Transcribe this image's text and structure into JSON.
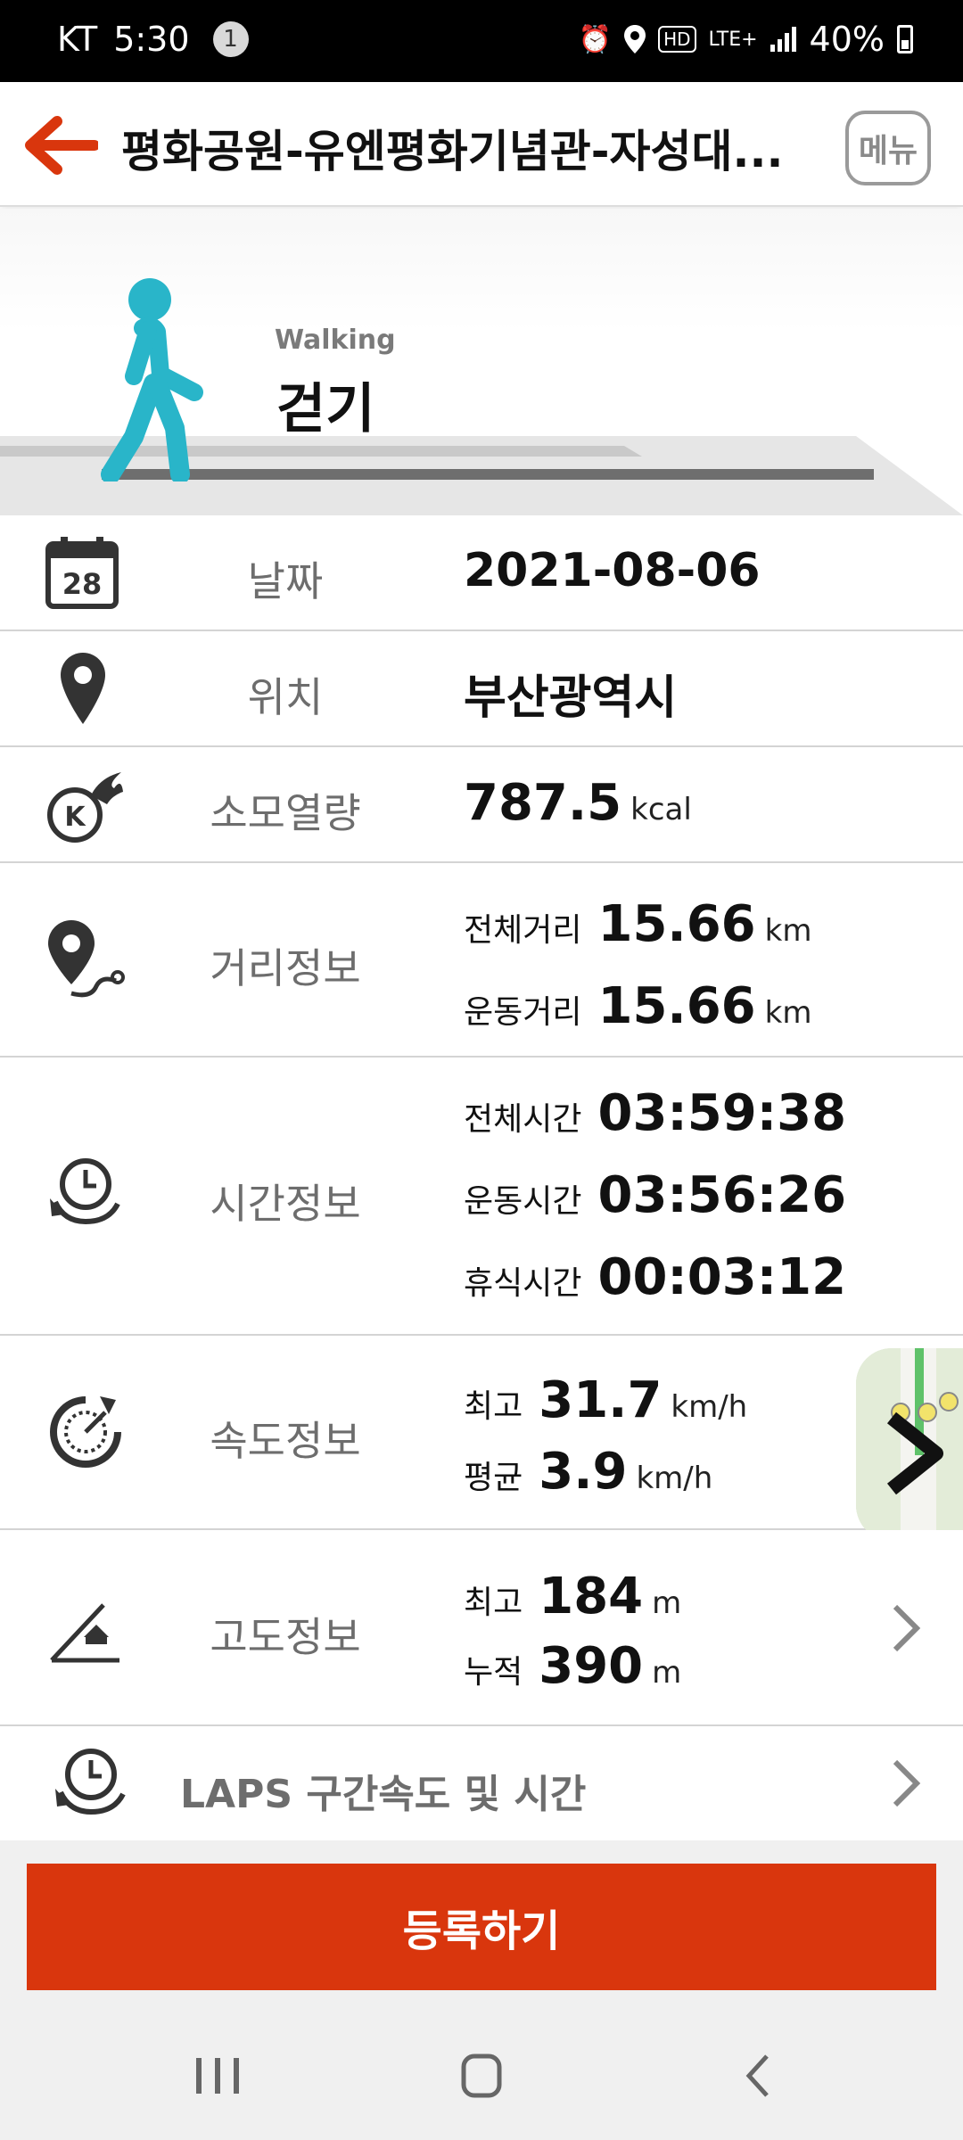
{
  "status_bar": {
    "carrier": "KT",
    "time": "5:30",
    "notification_count": "1",
    "network": "LTE+",
    "hd_label": "HD",
    "battery": "40%"
  },
  "header": {
    "title": "평화공원-유엔평화기념관-자성대...",
    "menu_label": "메뉴"
  },
  "activity": {
    "subtitle": "Walking",
    "title": "걷기"
  },
  "rows": {
    "date": {
      "icon_day": "28",
      "label": "날짜",
      "value": "2021-08-06"
    },
    "location": {
      "label": "위치",
      "value": "부산광역시"
    },
    "calories": {
      "label": "소모열량",
      "value": "787.5",
      "unit": "kcal"
    },
    "distance": {
      "label": "거리정보",
      "total_label": "전체거리",
      "total_value": "15.66",
      "total_unit": "km",
      "exercise_label": "운동거리",
      "exercise_value": "15.66",
      "exercise_unit": "km"
    },
    "time": {
      "label": "시간정보",
      "total_label": "전체시간",
      "total_value": "03:59:38",
      "exercise_label": "운동시간",
      "exercise_value": "03:56:26",
      "rest_label": "휴식시간",
      "rest_value": "00:03:12"
    },
    "speed": {
      "label": "속도정보",
      "max_label": "최고",
      "max_value": "31.7",
      "max_unit": "km/h",
      "avg_label": "평균",
      "avg_value": "3.9",
      "avg_unit": "km/h"
    },
    "altitude": {
      "label": "고도정보",
      "max_label": "최고",
      "max_value": "184",
      "max_unit": "m",
      "cum_label": "누적",
      "cum_value": "390",
      "cum_unit": "m"
    }
  },
  "laps": {
    "label": "LAPS 구간속도 및 시간"
  },
  "register_button": "등록하기",
  "colors": {
    "accent": "#d9360d",
    "walker": "#29b5c9",
    "label_gray": "#6d6d6d"
  }
}
